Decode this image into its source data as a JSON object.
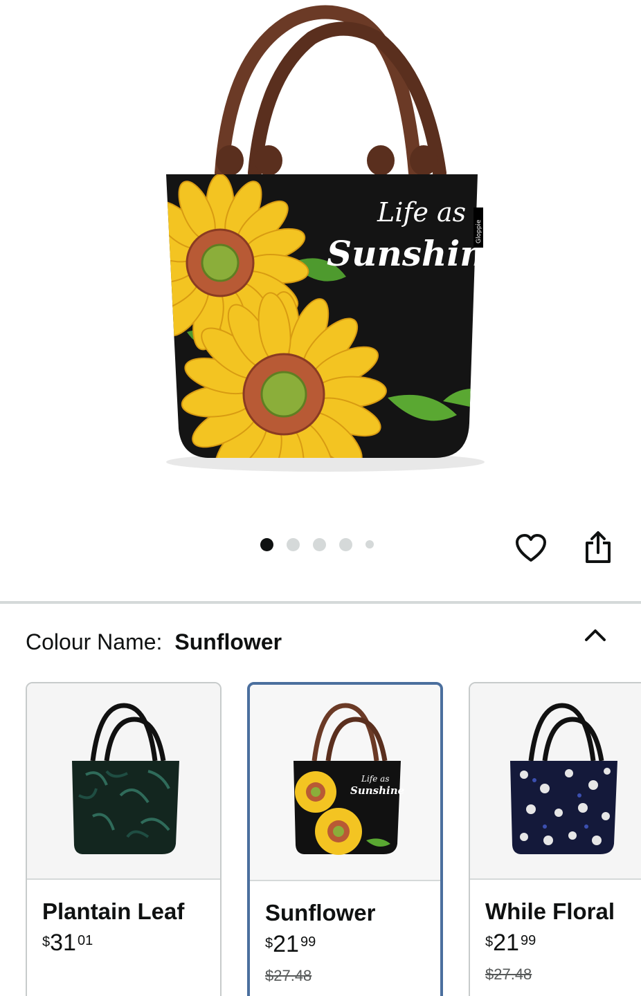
{
  "gallery": {
    "bag_text": {
      "line1": "Life as",
      "line2": "Sunshine"
    },
    "brand_tag": "Gloppie",
    "image_count": 5,
    "active_index": 0,
    "actions": {
      "favorite_icon": "heart-icon",
      "share_icon": "share-icon"
    }
  },
  "variation": {
    "label": "Colour Name:",
    "selected": "Sunflower",
    "toggle_icon": "chevron-up-icon"
  },
  "swatches": [
    {
      "name": "Plantain Leaf",
      "currency": "$",
      "whole": "31",
      "fraction": "01",
      "was": "",
      "bag_color": "#13261f"
    },
    {
      "name": "Sunflower",
      "currency": "$",
      "whole": "21",
      "fraction": "99",
      "was": "$27.48",
      "bag_color": "#111111"
    },
    {
      "name": "While Floral",
      "currency": "$",
      "whole": "21",
      "fraction": "99",
      "was": "$27.48",
      "bag_color": "#14193a"
    }
  ],
  "colors": {
    "selected_border": "#4b6f9e",
    "handle_brown": "#6b3a26",
    "petal_yellow": "#f3c422"
  }
}
